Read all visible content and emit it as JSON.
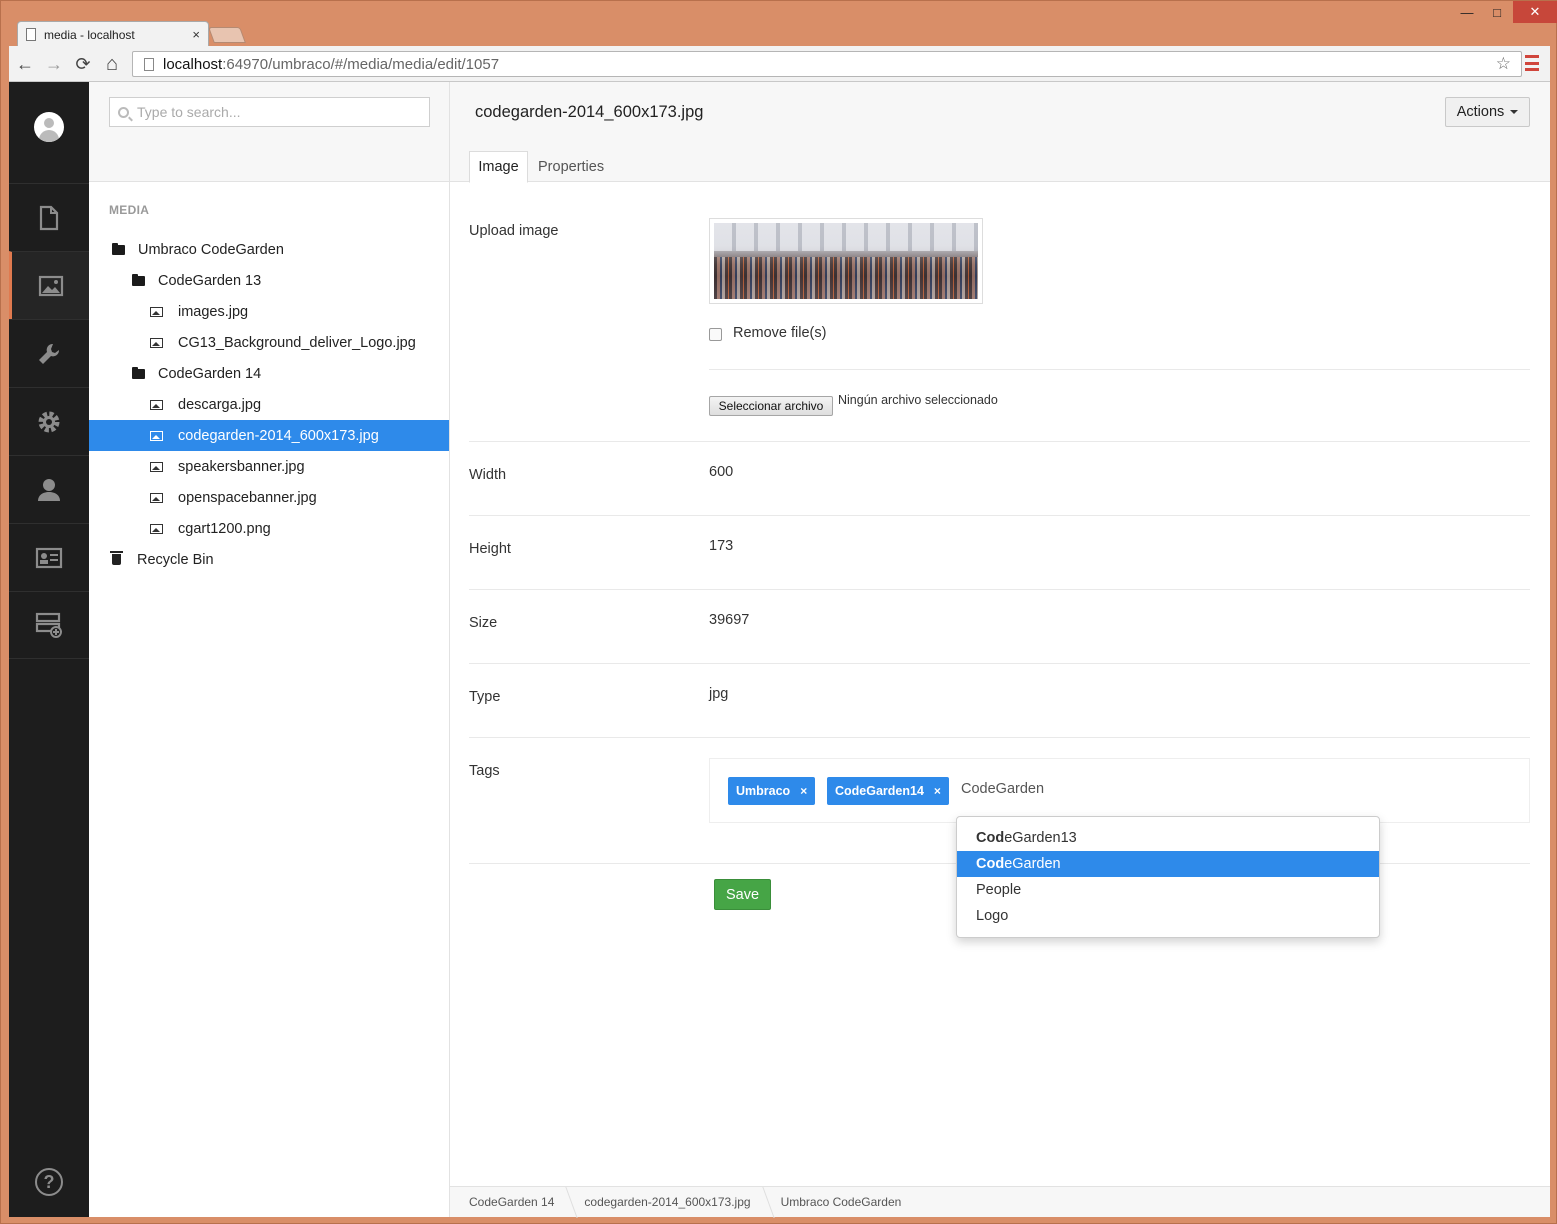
{
  "browser": {
    "tab_title": "media - localhost",
    "tab_close": "×",
    "url_host": "localhost",
    "url_path": ":64970/umbraco/#/media/media/edit/1057",
    "win_min": "—",
    "win_max": "□",
    "win_close": "✕",
    "back": "←",
    "forward": "→",
    "reload": "⟳",
    "home": "⌂",
    "star": "☆"
  },
  "sections": {
    "items": [
      {
        "name": "content",
        "icon": "document-icon"
      },
      {
        "name": "media",
        "icon": "image-icon",
        "active": true
      },
      {
        "name": "developer",
        "icon": "wrench-icon"
      },
      {
        "name": "settings",
        "icon": "gear-icon"
      },
      {
        "name": "users",
        "icon": "user-icon"
      },
      {
        "name": "members",
        "icon": "id-card-icon"
      },
      {
        "name": "forms",
        "icon": "stack-plus-icon"
      }
    ],
    "help": "?"
  },
  "tree": {
    "search_placeholder": "Type to search...",
    "section_label": "MEDIA",
    "nodes": [
      {
        "label": "Umbraco CodeGarden",
        "type": "folder"
      },
      {
        "label": "CodeGarden 13",
        "type": "folder"
      },
      {
        "label": "images.jpg",
        "type": "image"
      },
      {
        "label": "CG13_Background_deliver_Logo.jpg",
        "type": "image"
      },
      {
        "label": "CodeGarden 14",
        "type": "folder"
      },
      {
        "label": "descarga.jpg",
        "type": "image"
      },
      {
        "label": "codegarden-2014_600x173.jpg",
        "type": "image",
        "selected": true
      },
      {
        "label": "speakersbanner.jpg",
        "type": "image"
      },
      {
        "label": "openspacebanner.jpg",
        "type": "image"
      },
      {
        "label": "cgart1200.png",
        "type": "image"
      },
      {
        "label": "Recycle Bin",
        "type": "trash"
      }
    ]
  },
  "editor": {
    "title": "codegarden-2014_600x173.jpg",
    "actions_label": "Actions",
    "tabs": [
      "Image",
      "Properties"
    ],
    "upload_label": "Upload image",
    "remove_label": "Remove file(s)",
    "file_button": "Seleccionar archivo",
    "file_none": "Ningún archivo seleccionado",
    "fields": [
      {
        "label": "Width",
        "value": "600"
      },
      {
        "label": "Height",
        "value": "173"
      },
      {
        "label": "Size",
        "value": "39697"
      },
      {
        "label": "Type",
        "value": "jpg"
      }
    ],
    "tags_label": "Tags",
    "tags": [
      "Umbraco",
      "CodeGarden14"
    ],
    "tag_remove": "×",
    "tag_input": "CodeGarden",
    "suggestions": [
      {
        "match": "Cod",
        "rest": "eGarden13"
      },
      {
        "match": "Cod",
        "rest": "eGarden",
        "highlighted": true
      },
      {
        "match": "",
        "rest": "People"
      },
      {
        "match": "",
        "rest": "Logo"
      }
    ],
    "save_label": "Save"
  },
  "breadcrumb": [
    "CodeGarden 14",
    "codegarden-2014_600x173.jpg",
    "Umbraco CodeGarden"
  ],
  "colors": {
    "accent": "#2e8aea",
    "save": "#46a546",
    "section_active": "#e07a4f",
    "frame": "#d98e68"
  }
}
